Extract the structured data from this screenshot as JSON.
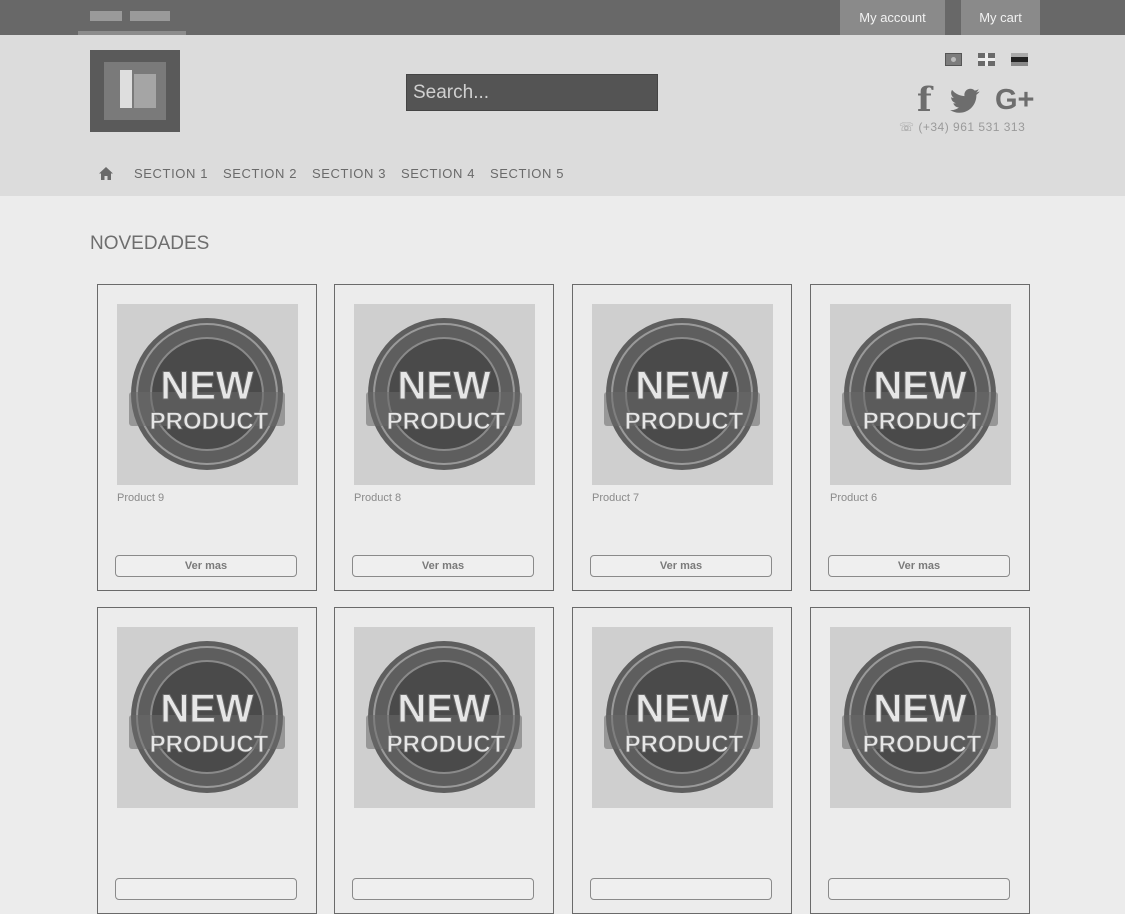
{
  "topbar": {
    "account_label": "My account",
    "cart_label": "My cart"
  },
  "header": {
    "search_placeholder": "Search...",
    "flags": [
      "flag-1-icon",
      "flag-uk-icon",
      "flag-3-icon"
    ],
    "social": {
      "facebook": "f",
      "googleplus": "G+"
    },
    "phone": "(+34) 961 531 313"
  },
  "nav": {
    "home_icon": "home-icon",
    "items": [
      "SECTION 1",
      "SECTION 2",
      "SECTION 3",
      "SECTION 4",
      "SECTION 5"
    ]
  },
  "main": {
    "title": "NOVEDADES",
    "products": [
      {
        "name": "Product 9",
        "button": "Ver mas",
        "image_text": [
          "NEW",
          "PRODUCT"
        ]
      },
      {
        "name": "Product 8",
        "button": "Ver mas",
        "image_text": [
          "NEW",
          "PRODUCT"
        ]
      },
      {
        "name": "Product 7",
        "button": "Ver mas",
        "image_text": [
          "NEW",
          "PRODUCT"
        ]
      },
      {
        "name": "Product 6",
        "button": "Ver mas",
        "image_text": [
          "NEW",
          "PRODUCT"
        ]
      },
      {
        "name": "",
        "button": "",
        "image_text": [
          "NEW",
          "PRODUCT"
        ]
      },
      {
        "name": "",
        "button": "",
        "image_text": [
          "NEW",
          "PRODUCT"
        ]
      },
      {
        "name": "",
        "button": "",
        "image_text": [
          "NEW",
          "PRODUCT"
        ]
      },
      {
        "name": "",
        "button": "",
        "image_text": [
          "NEW",
          "PRODUCT"
        ]
      }
    ]
  }
}
